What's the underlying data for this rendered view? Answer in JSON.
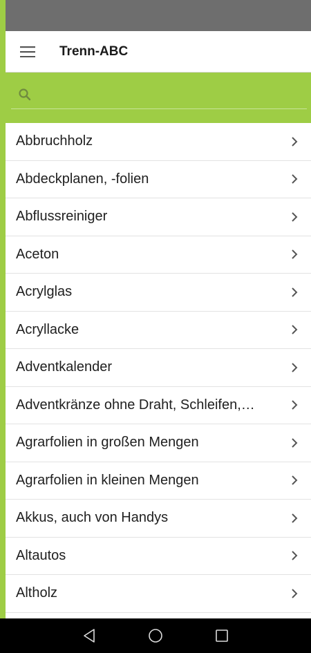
{
  "app": {
    "title": "Trenn-ABC"
  },
  "header": {
    "menu_icon": "hamburger-menu-icon"
  },
  "search": {
    "placeholder": "",
    "value": "",
    "icon": "search-icon"
  },
  "colors": {
    "accent": "#9ecd45",
    "status_bar": "#6e6e6e",
    "nav_bar": "#000000"
  },
  "list": {
    "items": [
      {
        "label": "Abbruchholz"
      },
      {
        "label": "Abdeckplanen, -folien"
      },
      {
        "label": "Abflussreiniger"
      },
      {
        "label": "Aceton"
      },
      {
        "label": "Acrylglas"
      },
      {
        "label": "Acryllacke"
      },
      {
        "label": "Adventkalender"
      },
      {
        "label": "Adventkränze ohne Draht, Schleifen,…"
      },
      {
        "label": "Agrarfolien in großen Mengen"
      },
      {
        "label": "Agrarfolien in kleinen Mengen"
      },
      {
        "label": "Akkus, auch von Handys"
      },
      {
        "label": "Altautos"
      },
      {
        "label": "Altholz"
      }
    ]
  },
  "navbar": {
    "back_icon": "back-triangle-icon",
    "home_icon": "home-circle-icon",
    "recents_icon": "recents-square-icon"
  }
}
